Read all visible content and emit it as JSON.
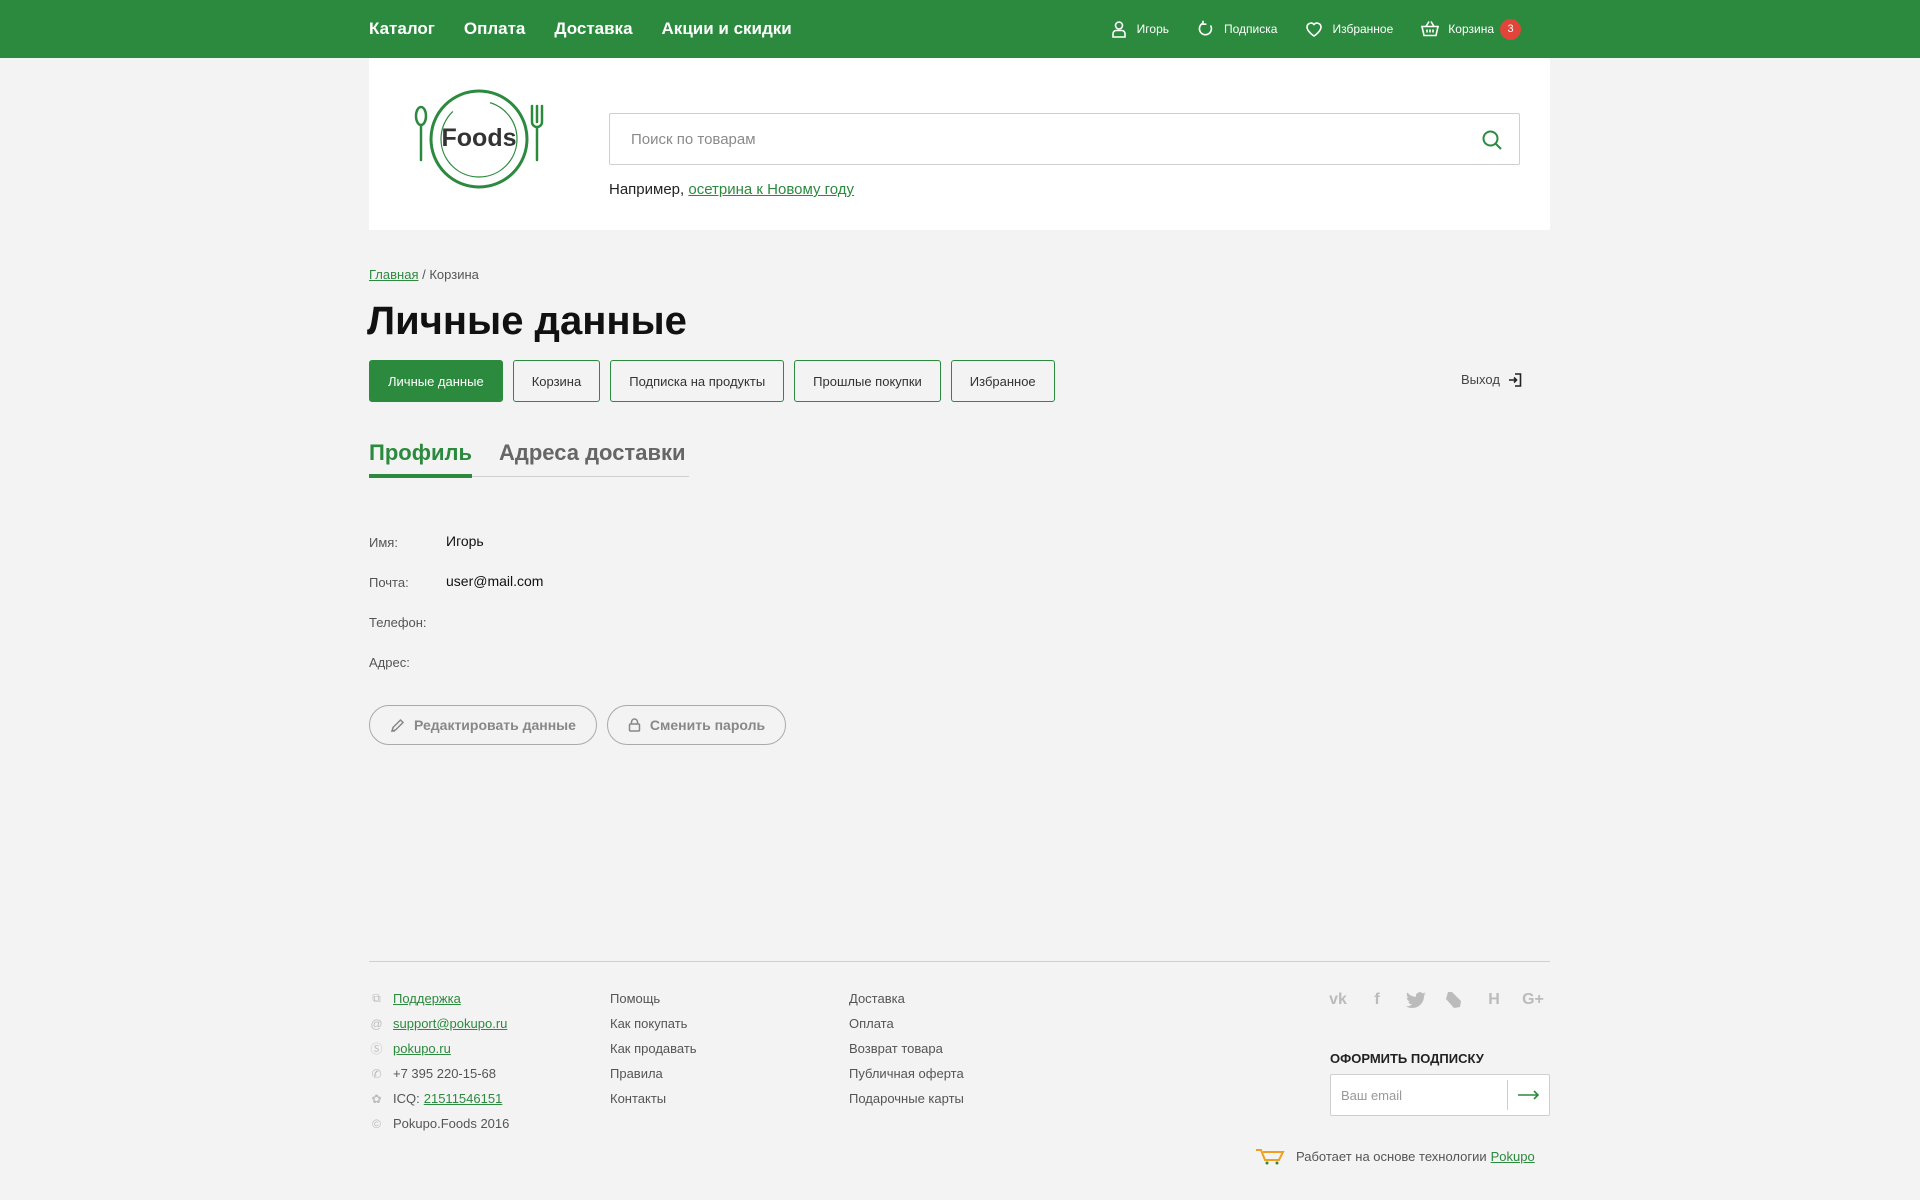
{
  "topnav": [
    "Каталог",
    "Оплата",
    "Доставка",
    "Акции и скидки"
  ],
  "user": {
    "name": "Игорь",
    "subscription": "Подписка",
    "favorites": "Избранное",
    "cart": "Корзина",
    "cart_count": "3"
  },
  "logo": {
    "text": "Foods"
  },
  "search": {
    "placeholder": "Поиск по товарам",
    "hint_prefix": "Например,",
    "hint_link": "осетрина к Новому году"
  },
  "breadcrumb": {
    "home": "Главная",
    "sep": "/",
    "current": "Корзина"
  },
  "page_title": "Личные данные",
  "account_tabs": [
    "Личные данные",
    "Корзина",
    "Подписка на продукты",
    "Прошлые покупки",
    "Избранное"
  ],
  "logout": "Выход",
  "profile_tabs": [
    "Профиль",
    "Адреса доставки"
  ],
  "fields": [
    {
      "label": "Имя:",
      "value": "Игорь"
    },
    {
      "label": "Почта:",
      "value": "user@mail.com"
    },
    {
      "label": "Телефон:",
      "value": ""
    },
    {
      "label": "Адрес:",
      "value": ""
    }
  ],
  "buttons": {
    "edit": "Редактировать данные",
    "change_password": "Сменить пароль"
  },
  "footer": {
    "contacts": {
      "support": "Поддержка",
      "email": "support@pokupo.ru",
      "site": "pokupo.ru",
      "phone": "+7 395 220-15-68",
      "icq_label": "ICQ:",
      "icq": "21511546151",
      "copyright": "Pokupo.Foods 2016"
    },
    "col2": [
      "Помощь",
      "Как покупать",
      "Как продавать",
      "Правила",
      "Контакты"
    ],
    "col3": [
      "Доставка",
      "Оплата",
      "Возврат товара",
      "Публичная оферта",
      "Подарочные карты"
    ],
    "subscribe_title": "ОФОРМИТЬ ПОДПИСКУ",
    "subscribe_placeholder": "Ваш email",
    "powered_text": "Работает на основе технологии",
    "powered_link": "Pokupo"
  },
  "colors": {
    "brand": "#2b8a3e",
    "badge": "#e2443a",
    "background": "#f3f3f3"
  },
  "icons": [
    "user-icon",
    "refresh-icon",
    "heart-icon",
    "basket-icon",
    "search-icon",
    "logout-icon",
    "pencil-icon",
    "lock-icon",
    "arrow-right-icon"
  ]
}
